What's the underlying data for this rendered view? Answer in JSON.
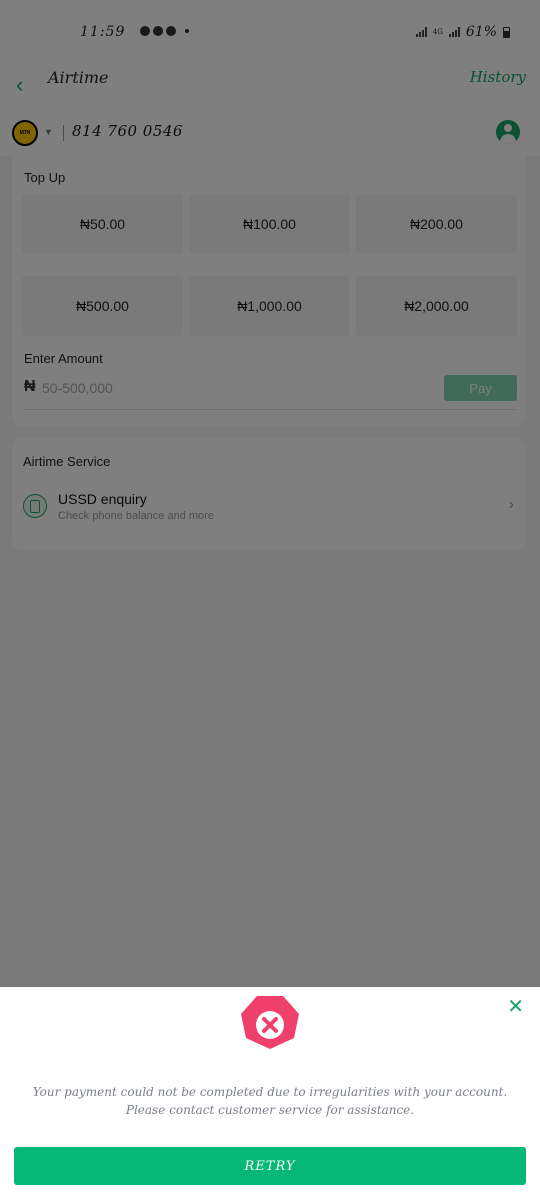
{
  "status_bar": {
    "time": "11:59",
    "battery": "61%",
    "network": "4G"
  },
  "header": {
    "title": "Airtime",
    "history_label": "History"
  },
  "phone": {
    "network_logo_text": "MTN",
    "number": "814 760 0546"
  },
  "topup": {
    "title": "Top Up",
    "amounts": [
      "₦50.00",
      "₦100.00",
      "₦200.00",
      "₦500.00",
      "₦1,000.00",
      "₦2,000.00"
    ],
    "enter_label": "Enter Amount",
    "currency_symbol": "₦",
    "placeholder": "50-500,000",
    "pay_label": "Pay"
  },
  "service": {
    "title": "Airtime Service",
    "ussd_icon_text": "USSD",
    "ussd_title": "USSD enquiry",
    "ussd_sub": "Check phone balance and more"
  },
  "dialog": {
    "message": "Your payment could not be completed due to irregularities with your account. Please contact customer service for assistance.",
    "retry_label": "RETRY"
  },
  "colors": {
    "accent": "#18a367",
    "error": "#ef3f6b",
    "retry": "#06b878"
  }
}
